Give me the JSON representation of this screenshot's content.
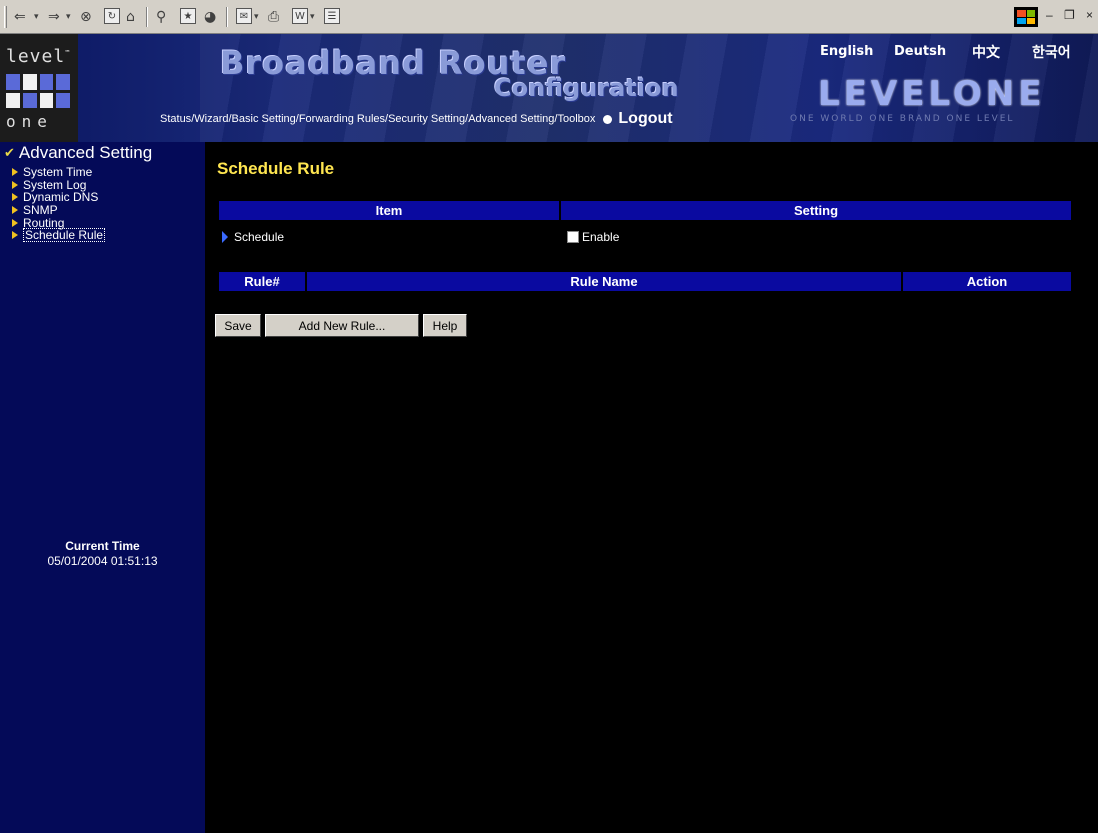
{
  "browser": {
    "toolbar_icons": [
      "back-icon",
      "forward-icon",
      "stop-icon",
      "refresh-icon",
      "home-icon",
      "search-icon",
      "favorites-icon",
      "history-icon",
      "mail-icon",
      "print-icon",
      "edit-icon",
      "discuss-icon"
    ],
    "window_controls": [
      "minimize",
      "restore",
      "close"
    ]
  },
  "header": {
    "logo_top": "level",
    "logo_tm": "™",
    "logo_bottom": "one",
    "title_line1": "Broadband Router",
    "title_line2": "Configuration",
    "brand": "LEVELONE",
    "tagline": "ONE WORLD  ONE BRAND  ONE LEVEL",
    "languages": [
      "English",
      "Deutsh",
      "中文",
      "한국어"
    ],
    "nav": [
      "Status",
      "Wizard",
      "Basic Setting",
      "Forwarding Rules",
      "Security Setting",
      "Advanced Setting",
      "Toolbox"
    ],
    "nav_separator": "/ ",
    "logout": "Logout"
  },
  "sidebar": {
    "section_title": "Advanced Setting",
    "items": [
      {
        "label": "System Time"
      },
      {
        "label": "System Log"
      },
      {
        "label": "Dynamic DNS"
      },
      {
        "label": "SNMP"
      },
      {
        "label": "Routing"
      },
      {
        "label": "Schedule Rule",
        "active": true
      }
    ],
    "current_time_label": "Current Time",
    "current_time_value": "05/01/2004 01:51:13"
  },
  "main": {
    "page_title": "Schedule Rule",
    "settings_table": {
      "col_item": "Item",
      "col_setting": "Setting",
      "row_label": "Schedule",
      "checkbox_label": "Enable",
      "checked": false
    },
    "rules_table": {
      "col_rule": "Rule#",
      "col_name": "Rule Name",
      "col_action": "Action"
    },
    "buttons": {
      "save": "Save",
      "add": "Add New Rule...",
      "help": "Help"
    }
  },
  "colors": {
    "sidebar_bg": "#040a58",
    "table_header_bg": "#0a0aa0",
    "title_yellow": "#ffe650",
    "content_bg": "#000000"
  }
}
